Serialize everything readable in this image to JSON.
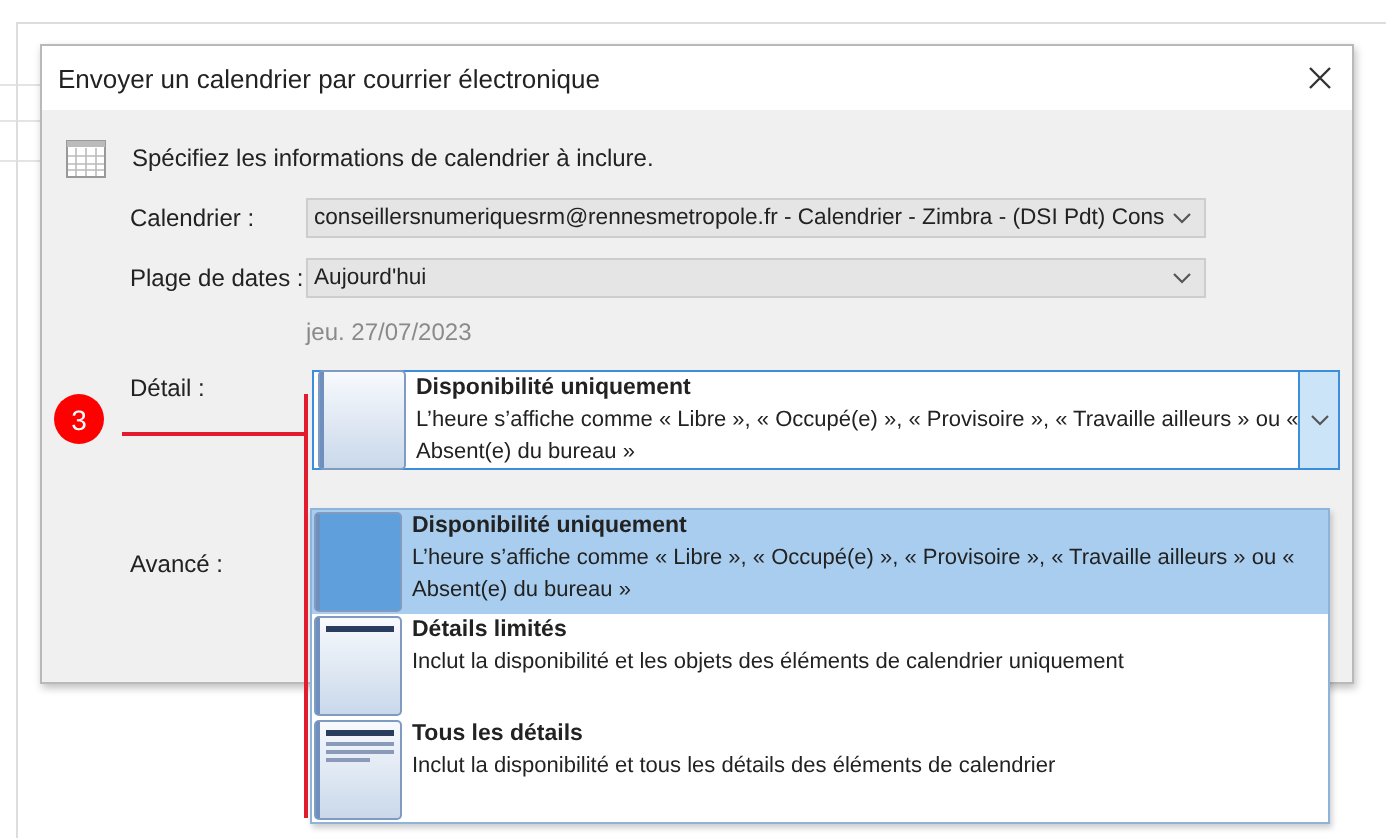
{
  "window": {
    "title": "Envoyer un calendrier par courrier électronique"
  },
  "instruction": "Spécifiez les informations de calendrier à inclure.",
  "fields": [
    {
      "label": "Calendrier :",
      "value": "conseillersnumeriquesrm@rennesmetropole.fr - Calendrier - Zimbra - (DSI Pdt) Cons"
    },
    {
      "label": "Plage de dates :",
      "value": "Aujourd'hui"
    }
  ],
  "date_note": "jeu. 27/07/2023",
  "detail": {
    "label": "Détail :",
    "expanded": true,
    "value": {
      "kind": "availability",
      "title": "Disponibilité uniquement",
      "description": "L’heure s’affiche comme « Libre », « Occupé(e) », « Provisoire », « Travaille ailleurs » ou « Absent(e) du bureau »"
    },
    "options": [
      {
        "kind": "availability",
        "title": "Disponibilité uniquement",
        "description": "L’heure s’affiche comme « Libre », « Occupé(e) », « Provisoire », « Travaille ailleurs » ou « Absent(e) du bureau »",
        "selected": true
      },
      {
        "kind": "limited",
        "title": "Détails limités",
        "description": "Inclut la disponibilité et les objets des éléments de calendrier uniquement",
        "selected": false
      },
      {
        "kind": "full",
        "title": "Tous les détails",
        "description": "Inclut la disponibilité et tous les détails des éléments de calendrier",
        "selected": false
      }
    ]
  },
  "advanced": {
    "label": "Avancé :"
  },
  "annotation": {
    "number": "3"
  }
}
